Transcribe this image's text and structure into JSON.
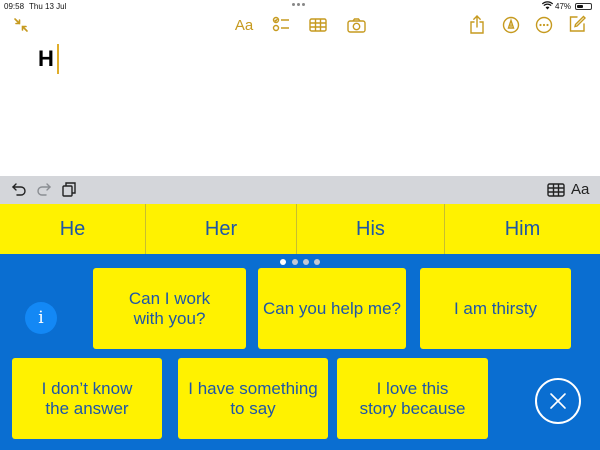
{
  "status_bar": {
    "time": "09:58",
    "date": "Thu 13 Jul",
    "battery": "47%",
    "battery_level": 0.47
  },
  "toolbar": {
    "collapse_icon": "collapse-arrows-icon",
    "format_label": "Aa",
    "checklist_icon": "checklist-icon",
    "table_icon": "table-icon",
    "camera_icon": "camera-icon",
    "share_icon": "share-icon",
    "markup_icon": "markup-pen-icon",
    "more_icon": "more-icon",
    "compose_icon": "compose-icon",
    "accent_color": "#c69a1f"
  },
  "note": {
    "text": "H"
  },
  "keyboard_bar": {
    "format_label": "Aa",
    "undo_icon": "undo-icon",
    "redo_icon": "redo-icon",
    "paste_icon": "paste-icon",
    "table_icon": "table-icon"
  },
  "predictions": [
    "He",
    "Her",
    "His",
    "Him"
  ],
  "aac": {
    "page_count": 4,
    "active_page": 1,
    "row1": [
      "Can I work\nwith you?",
      "Can you help me?",
      "I am thirsty"
    ],
    "row2": [
      "I don’t know\nthe answer",
      "I have something\nto say",
      "I love this\nstory because"
    ],
    "info_label": "i",
    "background_color": "#0a6ed1",
    "tile_color": "#fff200",
    "text_color": "#1e56a8"
  }
}
